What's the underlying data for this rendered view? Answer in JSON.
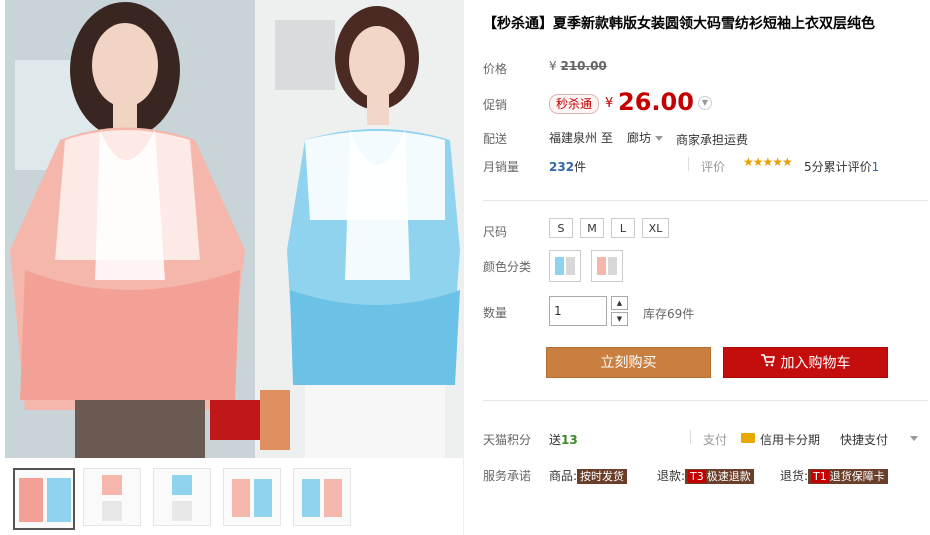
{
  "title": "【秒杀通】夏季新款韩版女装圆领大码雪纺衫短袖上衣双层纯色",
  "price": {
    "label": "价格",
    "currency": "¥",
    "original": "210.00"
  },
  "promo": {
    "label": "促销",
    "badge": "秒杀通",
    "currency": "¥",
    "current": "26.00"
  },
  "shipping": {
    "label": "配送",
    "from": "福建泉州",
    "to_word": "至",
    "to": "廊坊",
    "fee": "商家承担运费"
  },
  "sales": {
    "label": "月销量",
    "count": "232",
    "unit": "件"
  },
  "rating": {
    "label": "评价",
    "stars": "★★★★★",
    "score_text": "5分累计评价",
    "count": "1"
  },
  "size": {
    "label": "尺码",
    "options": [
      "S",
      "M",
      "L",
      "XL"
    ]
  },
  "color": {
    "label": "颜色分类"
  },
  "quantity": {
    "label": "数量",
    "value": "1",
    "stock": "库存69件"
  },
  "actions": {
    "buy": "立刻购买",
    "cart": "加入购物车"
  },
  "points": {
    "label": "天猫积分",
    "prefix": "送",
    "value": "13"
  },
  "payment": {
    "label": "支付",
    "card": "信用卡分期",
    "quick": "快捷支付"
  },
  "service": {
    "label": "服务承诺",
    "goods_label": "商品:",
    "goods_tag": "按时发货",
    "return_label": "退款:",
    "return_code": "T3",
    "return_tag": "极速退款",
    "refund_label": "退货:",
    "refund_code": "T1",
    "refund_tag": "退货保障卡"
  },
  "colors": {
    "accent": "#c40000",
    "buy": "#c97f40",
    "cart": "#c40e0e",
    "pink": "#f2a49a",
    "blue": "#7cc7e8"
  }
}
